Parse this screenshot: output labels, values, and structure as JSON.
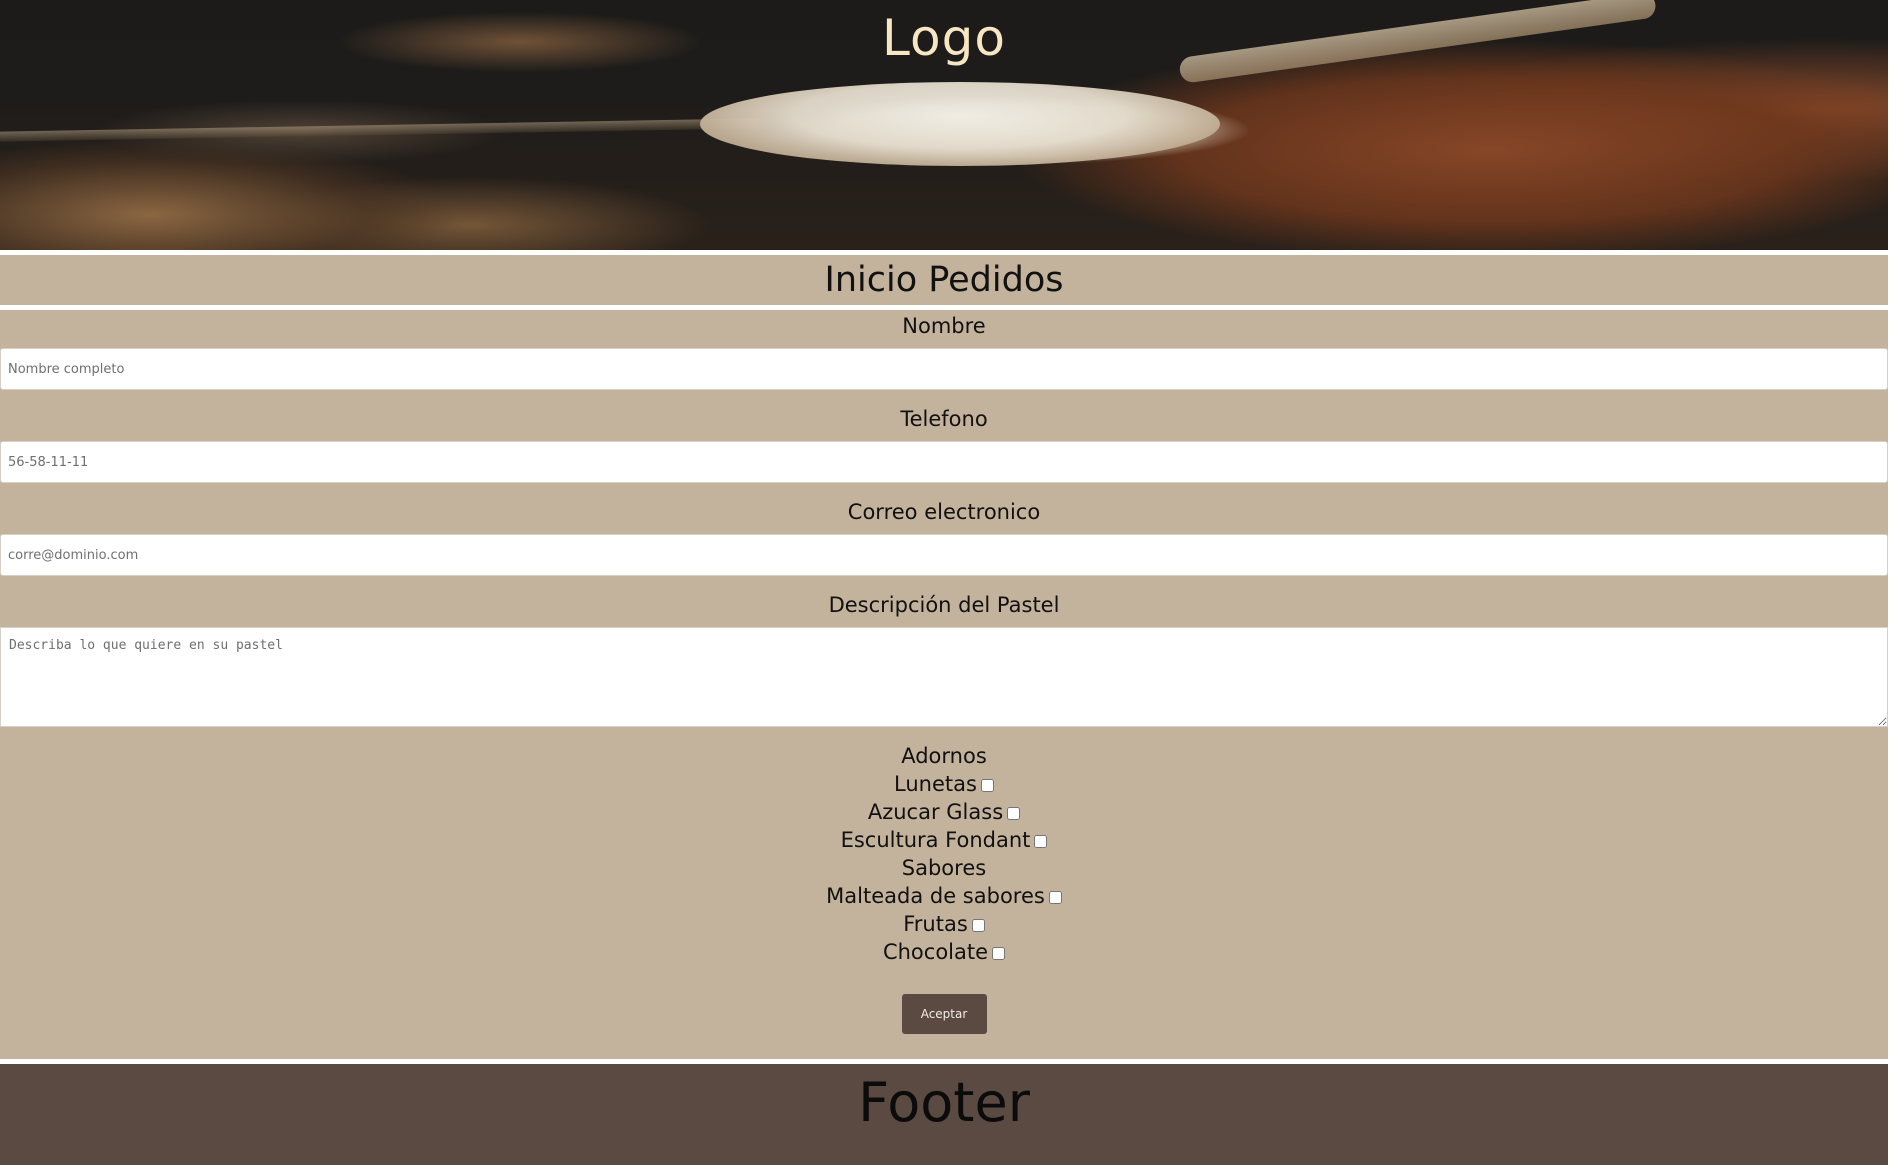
{
  "header": {
    "logo_text": "Logo"
  },
  "nav": {
    "title": "Inicio Pedidos"
  },
  "form": {
    "name": {
      "label": "Nombre",
      "placeholder": "Nombre completo",
      "value": ""
    },
    "phone": {
      "label": "Telefono",
      "placeholder": "56-58-11-11",
      "value": ""
    },
    "email": {
      "label": "Correo electronico",
      "placeholder": "corre@dominio.com",
      "value": ""
    },
    "description": {
      "label": "Descripción del Pastel",
      "placeholder": "Describa lo que quiere en su pastel",
      "value": ""
    },
    "adornos": {
      "heading": "Adornos",
      "options": [
        {
          "label": "Lunetas",
          "checked": false
        },
        {
          "label": "Azucar Glass",
          "checked": false
        },
        {
          "label": "Escultura Fondant",
          "checked": false
        }
      ]
    },
    "sabores": {
      "heading": "Sabores",
      "options": [
        {
          "label": "Malteada de sabores",
          "checked": false
        },
        {
          "label": "Frutas",
          "checked": false
        },
        {
          "label": "Chocolate",
          "checked": false
        }
      ]
    },
    "submit_label": "Aceptar"
  },
  "footer": {
    "text": "Footer"
  },
  "colors": {
    "panel": "#c4b39c",
    "footer": "#5b4a42",
    "button": "#5a4a42",
    "logo_text": "#f6e6c4"
  }
}
